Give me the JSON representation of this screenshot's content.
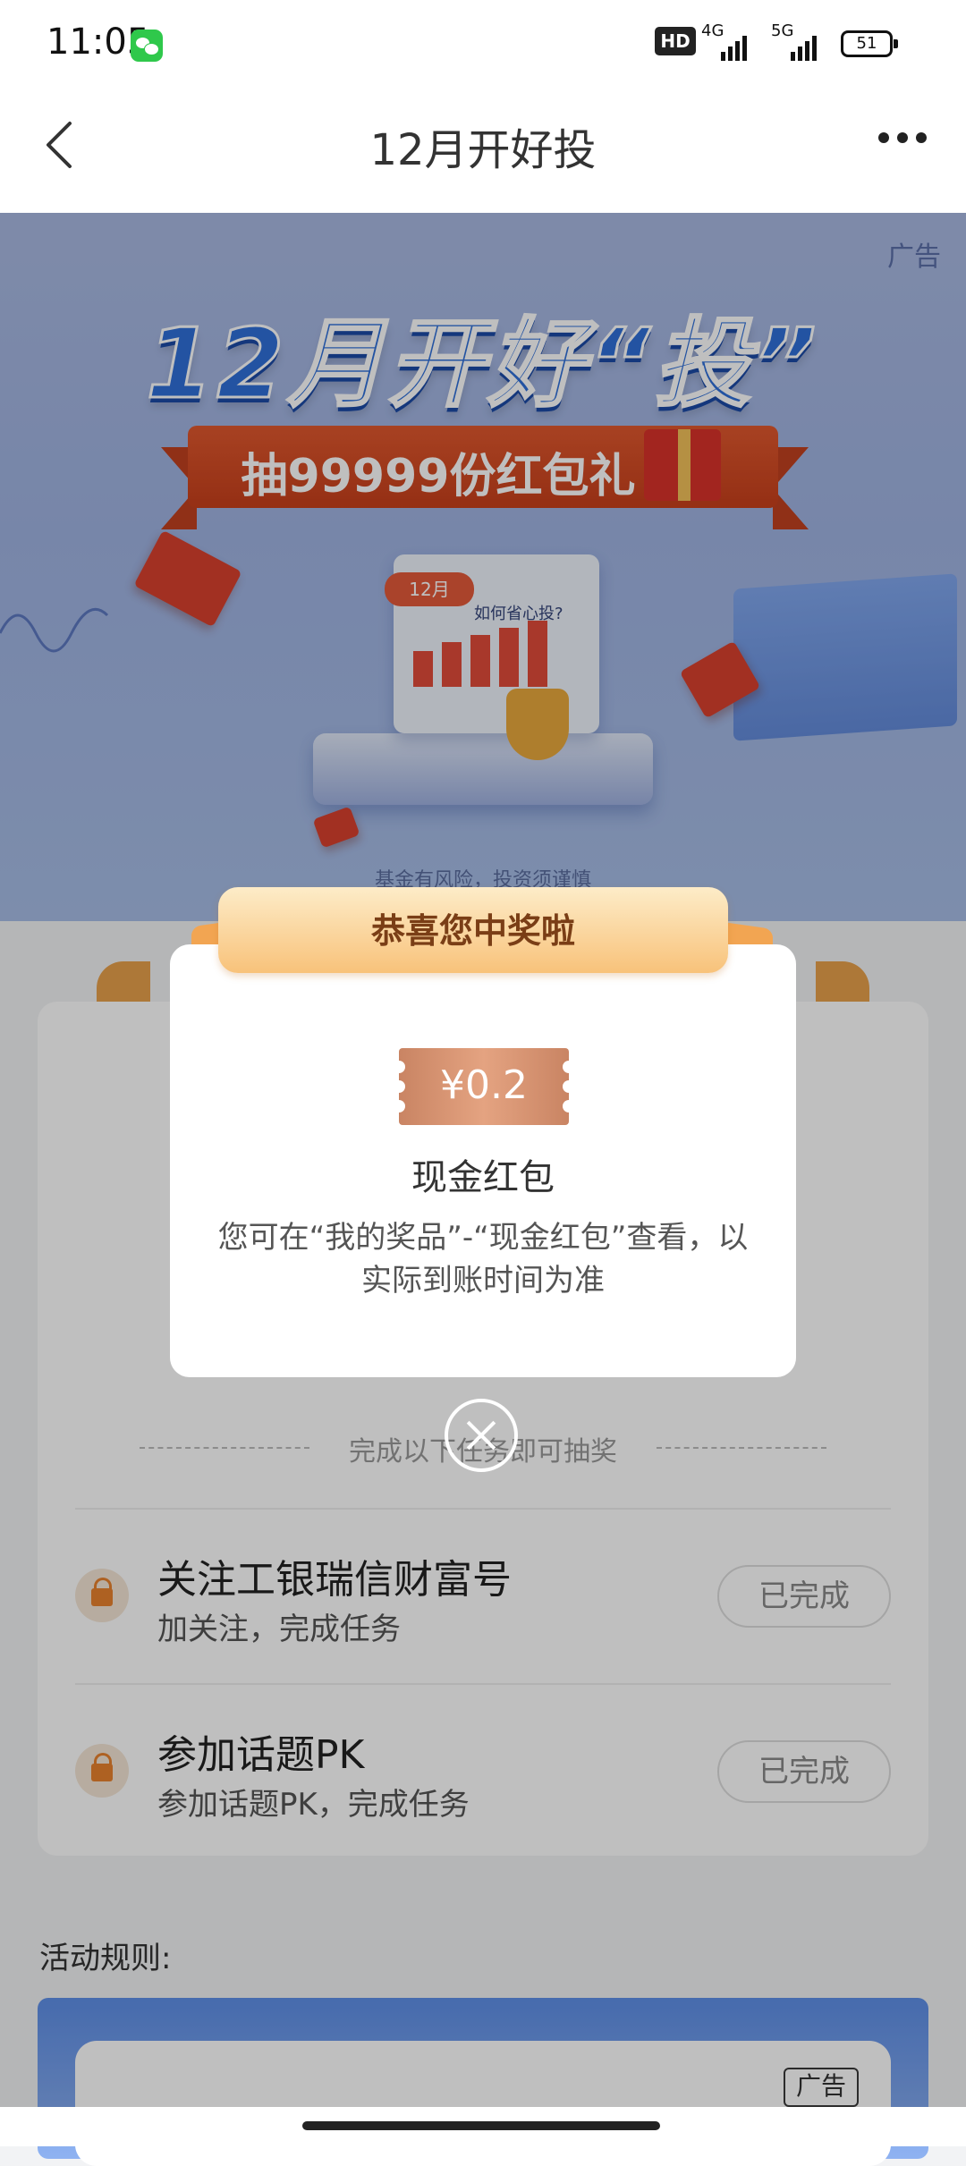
{
  "status_bar": {
    "time": "11:05",
    "network_1": "4G",
    "network_2": "5G",
    "hd": "HD",
    "battery": "51"
  },
  "nav": {
    "title": "12月开好投"
  },
  "banner": {
    "ad_tag": "广告",
    "title": "12月开好“投”",
    "ribbon": "抽99999份红包礼",
    "calendar_tab": "12月",
    "calendar_question": "如何省心投?",
    "risk_notice": "基金有风险，投资须谨慎"
  },
  "modal": {
    "title": "恭喜您中奖啦",
    "amount": "¥0.2",
    "prize_name": "现金红包",
    "description": "您可在“我的奖品”-“现金红包”查看，以实际到账时间为准"
  },
  "tasks": {
    "divider": "完成以下任务即可抽奖",
    "items": [
      {
        "title": "关注工银瑞信财富号",
        "subtitle": "加关注，完成任务",
        "status": "已完成"
      },
      {
        "title": "参加话题PK",
        "subtitle": "参加话题PK，完成任务",
        "status": "已完成"
      }
    ]
  },
  "rules": {
    "label": "活动规则:",
    "ad_tag": "广告"
  }
}
